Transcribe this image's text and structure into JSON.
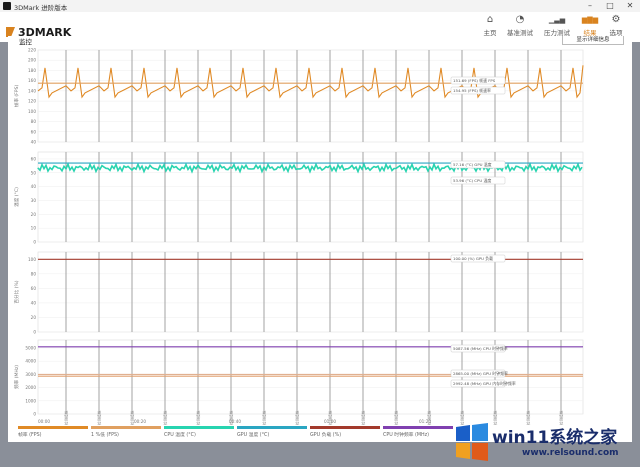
{
  "window": {
    "title": "3DMark 进阶版本"
  },
  "app": {
    "logo": "3DMARK"
  },
  "nav": [
    {
      "label": "主页",
      "icon": "home-icon",
      "glyph": "⌂"
    },
    {
      "label": "基准测试",
      "icon": "gauge-icon",
      "glyph": "◔"
    },
    {
      "label": "压力测试",
      "icon": "stress-chart-icon",
      "glyph": "▁▃▅"
    },
    {
      "label": "结果",
      "icon": "results-icon",
      "glyph": "▆▇▆"
    },
    {
      "label": "选项",
      "icon": "gear-icon",
      "glyph": "⚙"
    }
  ],
  "page": {
    "heading": "监控",
    "detail_button": "显示详细信息"
  },
  "colors": {
    "accent": "#d9831f",
    "fps": "#e08a26",
    "fps_avg": "#e0a060",
    "cpu_temp": "#28d4b0",
    "gpu_temp": "#2aa6c2",
    "gpu_load": "#a33a2c",
    "cpu_clock": "#8040b0",
    "gpu_mem_clock": "#e0a070"
  },
  "chart_data": {
    "type": "line",
    "x_ticks": [
      "00:00",
      "00:20",
      "00:40",
      "01:00",
      "01:20"
    ],
    "marker_label": "检测模拟",
    "panels": [
      {
        "ylabel": "帧率 (FPS)",
        "yticks": [
          "40",
          "60",
          "80",
          "100",
          "120",
          "140",
          "160",
          "180",
          "200",
          "220"
        ],
        "ylim": [
          40,
          220
        ],
        "series": [
          {
            "name": "帧率 (FPS)",
            "color": "#e08a26",
            "shape": "sawtooth",
            "base": 140,
            "low": 128,
            "peak": 185
          },
          {
            "name": "1 %低 (FPS)",
            "color": "#e0a060",
            "shape": "flat",
            "value": 155
          }
        ],
        "annotations": [
          "151.69 (FPS) 帧速 FPS",
          "154.95 (FPS) 帧速率"
        ]
      },
      {
        "ylabel": "温度 (°C)",
        "yticks": [
          "0",
          "10",
          "20",
          "30",
          "40",
          "50",
          "60"
        ],
        "ylim": [
          0,
          65
        ],
        "series": [
          {
            "name": "CPU 温度",
            "color": "#28d4b0",
            "shape": "noisy",
            "value": 53.5
          },
          {
            "name": "GPU 温度",
            "color": "#2aa6c2",
            "shape": "flat",
            "value": 57
          }
        ],
        "annotations": [
          "57.16 (°C) GPU 温度",
          "53.96 (°C) CPU 温度"
        ]
      },
      {
        "ylabel": "百分比 (%)",
        "yticks": [
          "0",
          "20",
          "40",
          "60",
          "80",
          "100"
        ],
        "ylim": [
          0,
          110
        ],
        "series": [
          {
            "name": "GPU 负载 (%)",
            "color": "#a33a2c",
            "shape": "flat",
            "value": 100
          }
        ],
        "annotations": [
          "100.00 (%) GPU 负载"
        ]
      },
      {
        "ylabel": "频率 (MHz)",
        "yticks": [
          "0",
          "1000",
          "2000",
          "3000",
          "4000",
          "5000"
        ],
        "ylim": [
          0,
          5600
        ],
        "series": [
          {
            "name": "CPU 时钟频率 (MHz)",
            "color": "#8040b0",
            "shape": "flat",
            "value": 5087
          },
          {
            "name": "GPU 内存时钟频率",
            "color": "#e0a070",
            "shape": "flat",
            "value": 2865
          },
          {
            "name": "GPU 时钟频率",
            "color": "#e0b090",
            "shape": "flat",
            "value": 2992
          }
        ],
        "annotations": [
          "5087.56 (MHz) CPU 时钟频率",
          "2865.00 (MHz) GPU 时钟频率",
          "2992.48 (MHz) GPU 内存时钟频率"
        ]
      }
    ]
  },
  "legend": [
    {
      "label": "帧率 (FPS)",
      "color": "#e08a26"
    },
    {
      "label": "1 %低 (FPS)",
      "color": "#e0a060"
    },
    {
      "label": "CPU 温度 (°C)",
      "color": "#28d4b0"
    },
    {
      "label": "GPU 温度 (°C)",
      "color": "#2aa6c2"
    },
    {
      "label": "GPU 负载 (%)",
      "color": "#a33a2c"
    },
    {
      "label": "CPU 时钟频率 (MHz)",
      "color": "#8040b0"
    }
  ],
  "watermark": {
    "text": "win11系统之家",
    "url": "www.relsound.com"
  }
}
